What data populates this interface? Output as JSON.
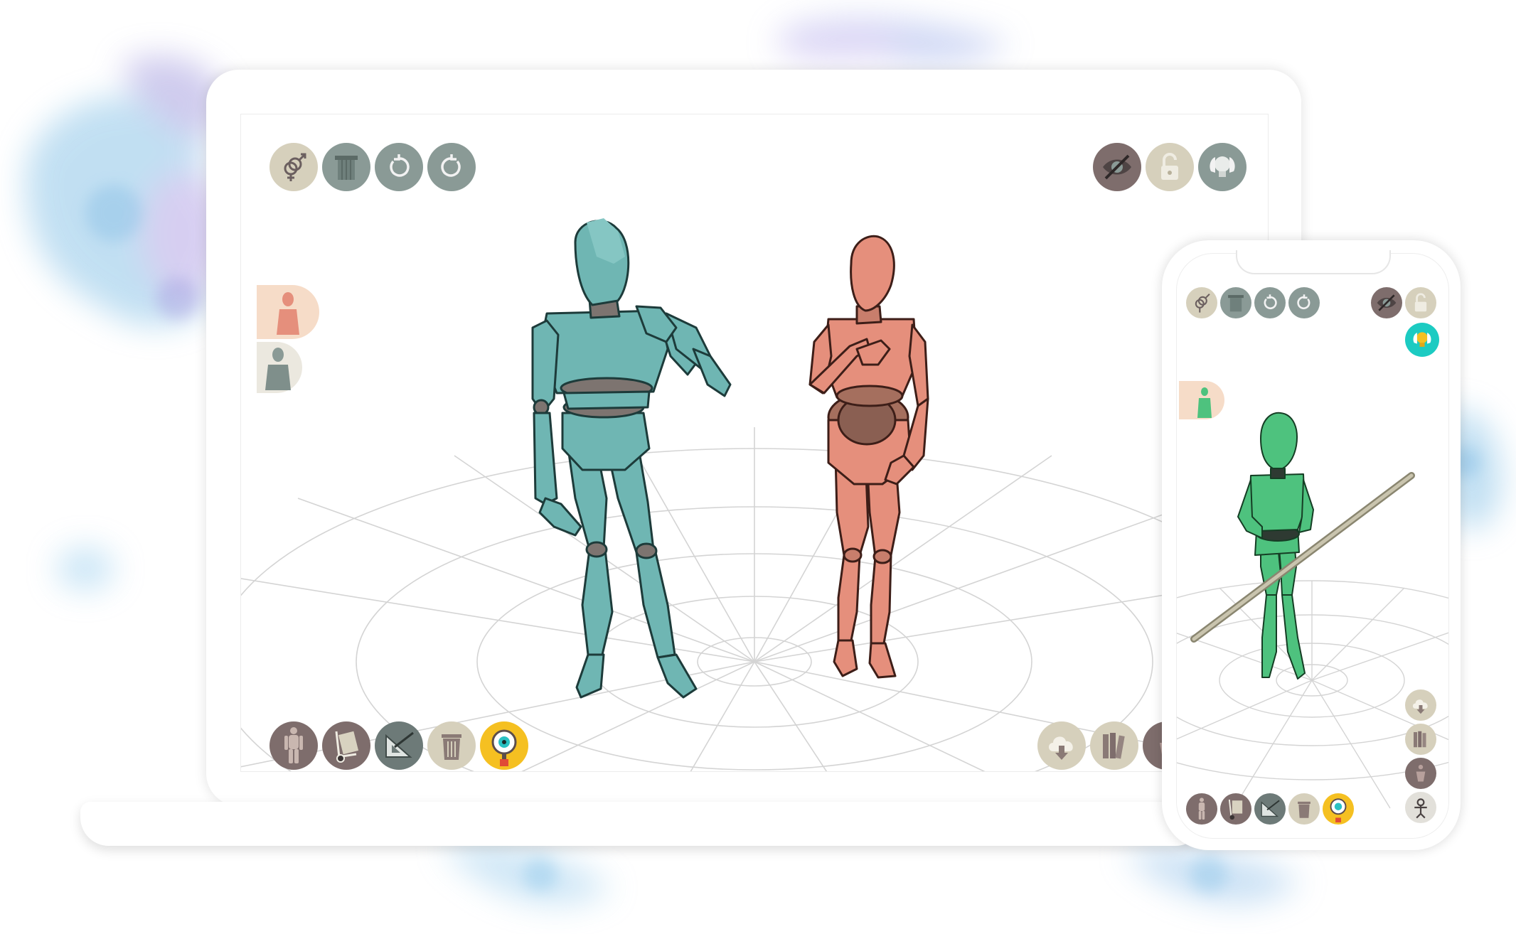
{
  "colors": {
    "button_beige": "#d6d0bc",
    "button_grey": "#8a9a96",
    "button_dark": "#7e6d6c",
    "button_yellow": "#f5c021",
    "button_teal": "#1ccbc2",
    "figure_teal": "#6fb6b3",
    "figure_salmon": "#e58f7c",
    "figure_green": "#4ec27e",
    "joint_grey": "#7d7470"
  },
  "laptop": {
    "toolbar_top_left": [
      {
        "name": "gender-toggle-button",
        "icon": "gender-icon",
        "color": "#d6d0bc"
      },
      {
        "name": "pedestal-button",
        "icon": "column-icon",
        "color": "#8a9a96"
      },
      {
        "name": "undo-button",
        "icon": "undo-icon",
        "color": "#8a9a96"
      },
      {
        "name": "redo-button",
        "icon": "redo-icon",
        "color": "#8a9a96"
      }
    ],
    "toolbar_top_right": [
      {
        "name": "visibility-toggle-button",
        "icon": "eye-slash-icon",
        "color": "#7e6d6c"
      },
      {
        "name": "lock-toggle-button",
        "icon": "padlock-open-icon",
        "color": "#d6d0bc"
      },
      {
        "name": "lighting-button",
        "icon": "lightbulb-icon",
        "color": "#8a9a96"
      }
    ],
    "model_list": [
      {
        "name": "model-tab-female",
        "icon": "mannequin-female-icon",
        "active": true
      },
      {
        "name": "model-tab-male",
        "icon": "mannequin-male-icon",
        "active": false
      }
    ],
    "toolbar_bottom_left": [
      {
        "name": "add-figure-button",
        "icon": "anatomy-figure-icon",
        "color": "#7e6d6c"
      },
      {
        "name": "props-button",
        "icon": "hand-truck-icon",
        "color": "#7e6d6c"
      },
      {
        "name": "measure-button",
        "icon": "set-square-icon",
        "color": "#8a9a96"
      },
      {
        "name": "delete-button",
        "icon": "trash-icon",
        "color": "#d6d0bc"
      },
      {
        "name": "camera-view-button",
        "icon": "eye-magnifier-icon",
        "color": "#f5c021"
      }
    ],
    "toolbar_bottom_right": [
      {
        "name": "cloud-download-button",
        "icon": "cloud-download-icon",
        "color": "#d6d0bc"
      },
      {
        "name": "library-button",
        "icon": "books-icon",
        "color": "#d6d0bc"
      },
      {
        "name": "pose-mirror-button",
        "icon": "figure-pose-icon",
        "color": "#7e6d6c"
      }
    ]
  },
  "phone": {
    "toolbar_top_left": [
      {
        "name": "phone-gender-toggle-button",
        "icon": "gender-icon"
      },
      {
        "name": "phone-pedestal-button",
        "icon": "column-icon"
      },
      {
        "name": "phone-undo-button",
        "icon": "undo-icon"
      },
      {
        "name": "phone-redo-button",
        "icon": "redo-icon"
      }
    ],
    "toolbar_top_right": [
      {
        "name": "phone-visibility-toggle-button",
        "icon": "eye-slash-icon"
      },
      {
        "name": "phone-lock-toggle-button",
        "icon": "padlock-open-icon"
      },
      {
        "name": "phone-lighting-button",
        "icon": "lightbulb-icon"
      }
    ],
    "model_list": [
      {
        "name": "phone-model-tab-green",
        "icon": "mannequin-green-icon",
        "active": true
      }
    ],
    "toolbar_bottom_left": [
      {
        "name": "phone-add-figure-button",
        "icon": "anatomy-figure-icon"
      },
      {
        "name": "phone-props-button",
        "icon": "hand-truck-icon"
      },
      {
        "name": "phone-measure-button",
        "icon": "set-square-icon"
      },
      {
        "name": "phone-delete-button",
        "icon": "trash-icon"
      },
      {
        "name": "phone-camera-view-button",
        "icon": "eye-magnifier-icon"
      }
    ],
    "toolbar_right": [
      {
        "name": "phone-cloud-download-button",
        "icon": "cloud-download-icon"
      },
      {
        "name": "phone-library-button",
        "icon": "books-icon"
      },
      {
        "name": "phone-pose-button",
        "icon": "figure-pose-icon"
      },
      {
        "name": "phone-skeleton-button",
        "icon": "skeleton-icon"
      }
    ]
  }
}
